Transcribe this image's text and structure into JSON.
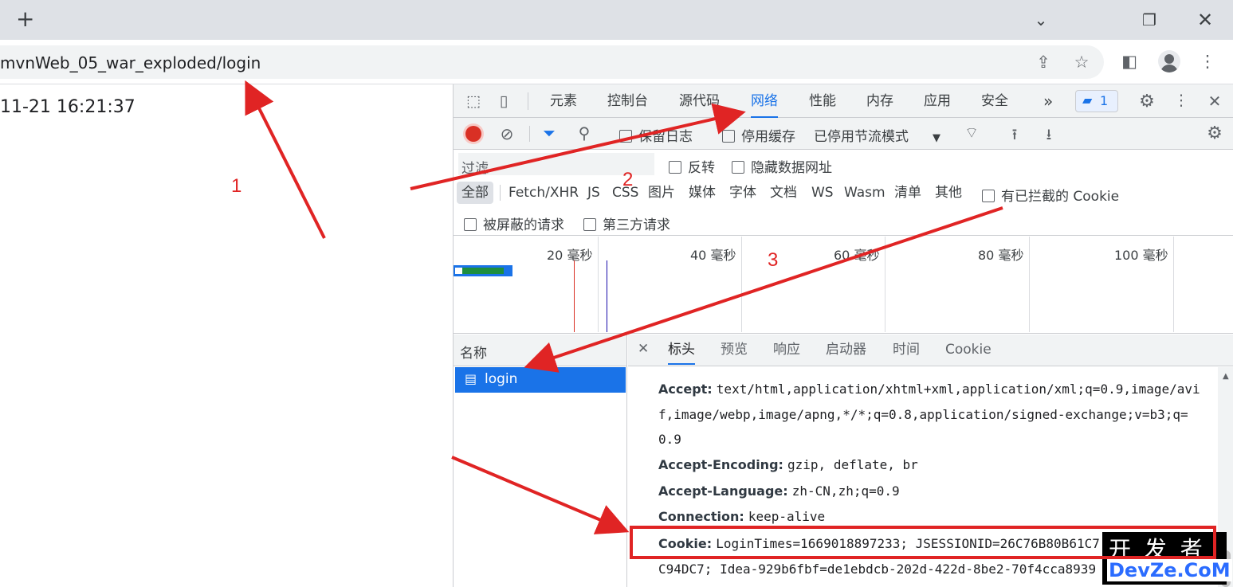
{
  "browser": {
    "new_tab_icon": "plus-icon",
    "url": "mvnWeb_05_war_exploded/login",
    "window_controls": {
      "minimize": "chevron-down-icon",
      "restore": "restore-icon",
      "close": "close-icon"
    }
  },
  "page": {
    "time_text": "11-21 16:21:37"
  },
  "devtools": {
    "main_tabs": [
      "元素",
      "控制台",
      "源代码",
      "网络",
      "性能",
      "内存",
      "应用",
      "安全"
    ],
    "active_tab": "网络",
    "more_tabs": "»",
    "issues_count": "1",
    "toolbar": {
      "preserve_log": "保留日志",
      "disable_cache": "停用缓存",
      "throttle": "已停用节流模式"
    },
    "filter": {
      "placeholder": "过滤",
      "invert": "反转",
      "hide_data_urls": "隐藏数据网址"
    },
    "types": [
      "全部",
      "Fetch/XHR",
      "JS",
      "CSS",
      "图片",
      "媒体",
      "字体",
      "文档",
      "WS",
      "Wasm",
      "清单",
      "其他"
    ],
    "active_type": "全部",
    "blocked_cookies": "有已拦截的 Cookie",
    "blocked_requests": "被屏蔽的请求",
    "third_party": "第三方请求",
    "timeline_ticks": [
      "20 毫秒",
      "40 毫秒",
      "60 毫秒",
      "80 毫秒",
      "100 毫秒"
    ],
    "name_header": "名称",
    "requests": [
      {
        "name": "login"
      }
    ],
    "panel_tabs": [
      "标头",
      "预览",
      "响应",
      "启动器",
      "时间",
      "Cookie"
    ],
    "active_panel_tab": "标头",
    "headers": [
      {
        "name": "Accept:",
        "value": "text/html,application/xhtml+xml,application/xml;q=0.9,image/avif,image/webp,image/apng,*/*;q=0.8,application/signed-exchange;v=b3;q=0.9",
        "lines": [
          "text/html,application/xhtml+xml,application/xml;q=0.9,image/avi",
          "f,image/webp,image/apng,*/*;q=0.8,application/signed-exchange;v=b3;q=",
          "0.9"
        ]
      },
      {
        "name": "Accept-Encoding:",
        "value": "gzip, deflate, br"
      },
      {
        "name": "Accept-Language:",
        "value": "zh-CN,zh;q=0.9"
      },
      {
        "name": "Connection:",
        "value": "keep-alive"
      },
      {
        "name": "Cookie:",
        "value": "LoginTimes=1669018897233; JSESSIONID=26C76B80B61C7",
        "cont": "C94DC7; Idea-929b6fbf=de1ebdcb-202d-422d-8be2-70f4cca8939"
      }
    ]
  },
  "annotations": [
    "1",
    "2",
    "3"
  ],
  "watermark": {
    "line1": "开 发 者",
    "line2": "DevZe.CoM"
  },
  "colors": {
    "accent": "#1a73e8",
    "annotation": "#e02424",
    "record": "#d93025"
  }
}
